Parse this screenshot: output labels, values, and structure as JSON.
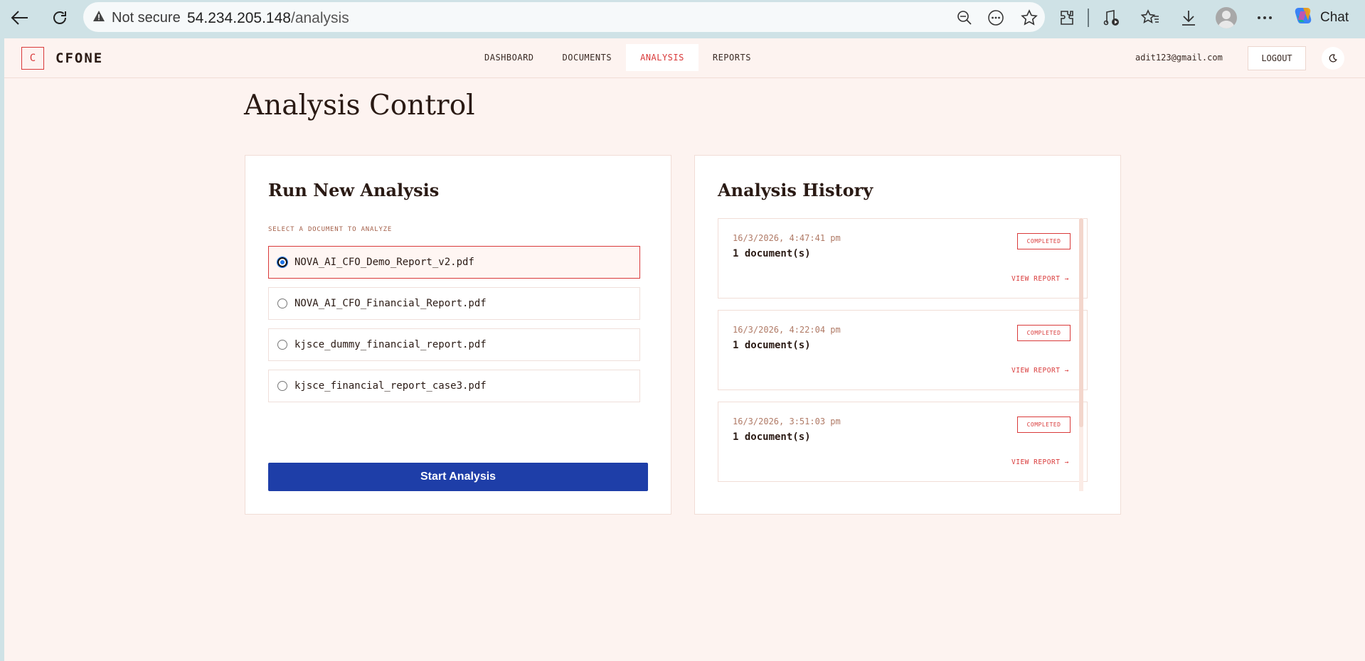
{
  "browser": {
    "security_label": "Not secure",
    "url_host": "54.234.205.148",
    "url_path": "/analysis",
    "chat_label": "Chat"
  },
  "header": {
    "logo_letter": "C",
    "logo_text": "CFONE",
    "nav": [
      {
        "label": "DASHBOARD",
        "active": false
      },
      {
        "label": "DOCUMENTS",
        "active": false
      },
      {
        "label": "ANALYSIS",
        "active": true
      },
      {
        "label": "REPORTS",
        "active": false
      }
    ],
    "user_email": "adit123@gmail.com",
    "logout_label": "LOGOUT"
  },
  "page": {
    "title": "Analysis Control"
  },
  "run_analysis": {
    "title": "Run New Analysis",
    "select_label": "SELECT A DOCUMENT TO ANALYZE",
    "documents": [
      {
        "name": "NOVA_AI_CFO_Demo_Report_v2.pdf",
        "selected": true
      },
      {
        "name": "NOVA_AI_CFO_Financial_Report.pdf",
        "selected": false
      },
      {
        "name": "kjsce_dummy_financial_report.pdf",
        "selected": false
      },
      {
        "name": "kjsce_financial_report_case3.pdf",
        "selected": false
      }
    ],
    "start_label": "Start Analysis"
  },
  "history": {
    "title": "Analysis History",
    "items": [
      {
        "timestamp": "16/3/2026, 4:47:41 pm",
        "docs": "1 document(s)",
        "status": "COMPLETED",
        "link": "VIEW REPORT →"
      },
      {
        "timestamp": "16/3/2026, 4:22:04 pm",
        "docs": "1 document(s)",
        "status": "COMPLETED",
        "link": "VIEW REPORT →"
      },
      {
        "timestamp": "16/3/2026, 3:51:03 pm",
        "docs": "1 document(s)",
        "status": "COMPLETED",
        "link": "VIEW REPORT →"
      }
    ]
  },
  "colors": {
    "accent": "#d93a3a",
    "primary_button": "#1e3ea8",
    "page_bg": "#fdf3f0"
  }
}
